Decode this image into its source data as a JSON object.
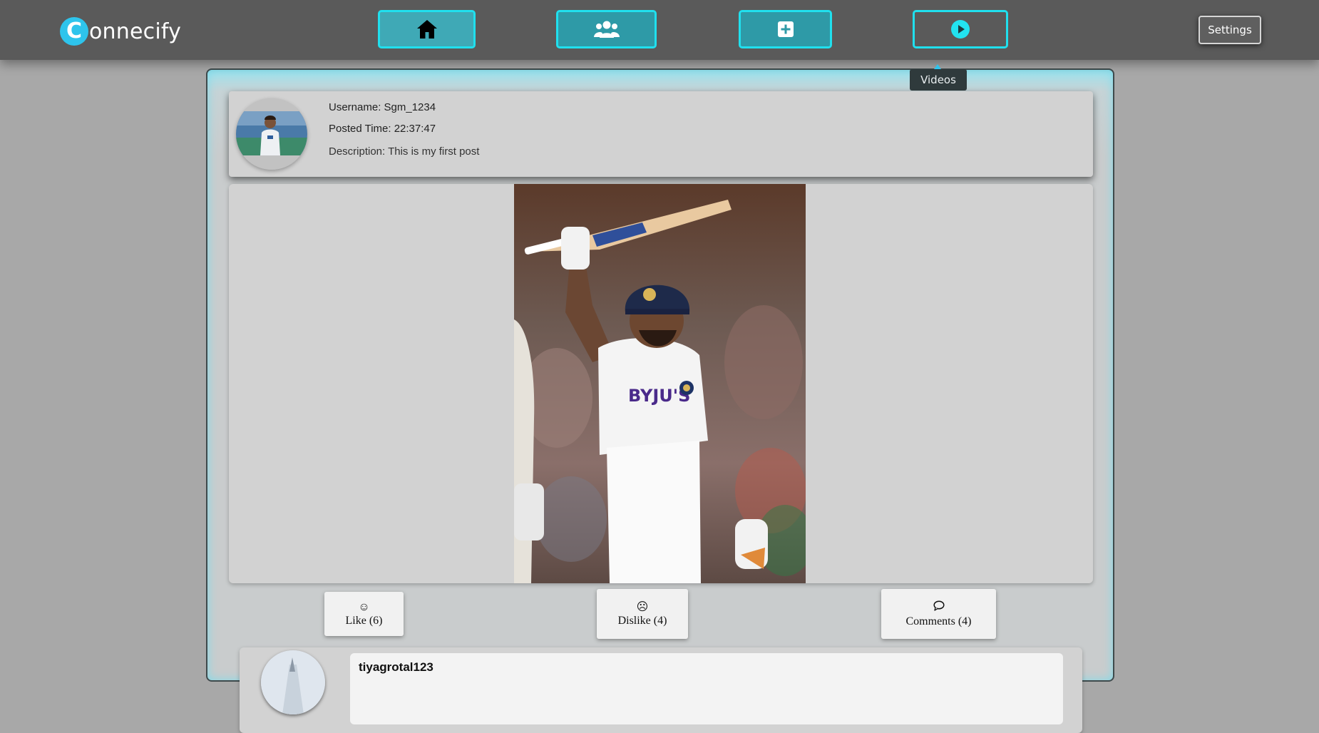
{
  "app": {
    "logo_letter": "C",
    "logo_rest": "onnecify",
    "brand_color": "#2ec4ec"
  },
  "nav": {
    "items": [
      {
        "name": "home",
        "icon": "house-icon"
      },
      {
        "name": "friends",
        "icon": "users-icon"
      },
      {
        "name": "create",
        "icon": "plus-square-icon"
      },
      {
        "name": "videos",
        "icon": "play-circle-icon"
      }
    ],
    "settings_label": "Settings",
    "tooltip": "Videos",
    "accent_color": "#20e0ee"
  },
  "post": {
    "username_label": "Username: Sgm_1234",
    "posted_time_label": "Posted Time: 22:37:47",
    "description_label": "Description: This is my first post",
    "avatar": "profile-photo",
    "photo": "cricketer-raising-bat-photo"
  },
  "actions": {
    "like_label": "Like (6)",
    "like_icon": "smile-icon",
    "dislike_label": "Dislike (4)",
    "dislike_icon": "frown-icon",
    "comments_label": "Comments (4)",
    "comments_icon": "speech-bubble-icon"
  },
  "comment": {
    "username": "tiyagrotal123"
  }
}
